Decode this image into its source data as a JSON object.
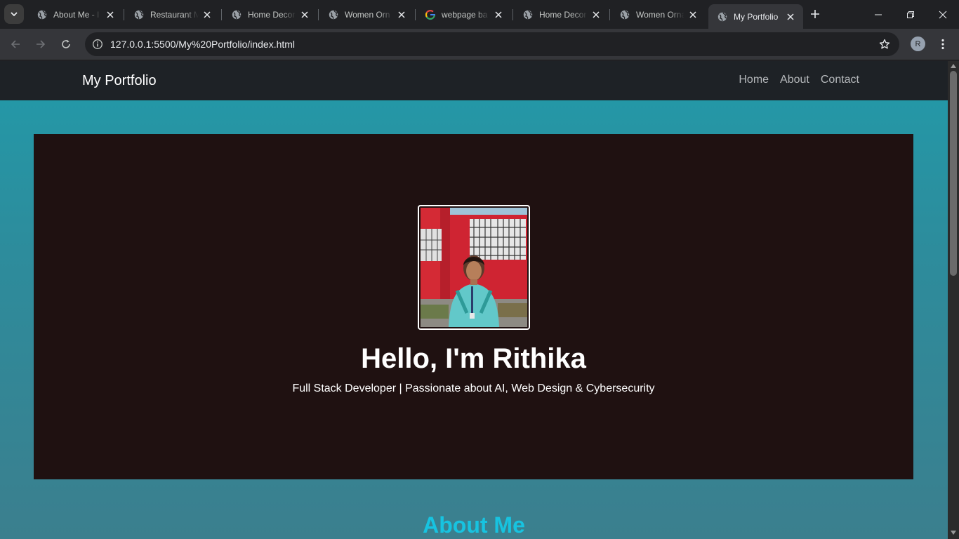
{
  "browser": {
    "tabs": [
      {
        "title": "About Me - I",
        "favicon": "globe-icon",
        "active": false
      },
      {
        "title": "Restaurant M",
        "favicon": "globe-icon",
        "active": false
      },
      {
        "title": "Home Decor",
        "favicon": "globe-icon",
        "active": false
      },
      {
        "title": "Women Orn",
        "favicon": "globe-icon",
        "active": false
      },
      {
        "title": "webpage ba",
        "favicon": "google-icon",
        "active": false
      },
      {
        "title": "Home Decor",
        "favicon": "globe-icon",
        "active": false
      },
      {
        "title": "Women Orna",
        "favicon": "globe-icon",
        "active": false
      },
      {
        "title": "My Portfolio",
        "favicon": "globe-icon",
        "active": true
      }
    ],
    "url": "127.0.0.1:5500/My%20Portfolio/index.html",
    "profile_initial": "R"
  },
  "site": {
    "brand": "My Portfolio",
    "nav": {
      "home": "Home",
      "about": "About",
      "contact": "Contact"
    },
    "hero": {
      "title": "Hello, I'm Rithika",
      "subtitle": "Full Stack Developer | Passionate about AI, Web Design & Cybersecurity"
    },
    "about_heading": "About Me"
  },
  "colors": {
    "navbar_bg": "#1e2226",
    "hero_bg": "#1f1111",
    "page_gradient_top": "#229aa9",
    "accent_heading": "#17c3e0"
  }
}
